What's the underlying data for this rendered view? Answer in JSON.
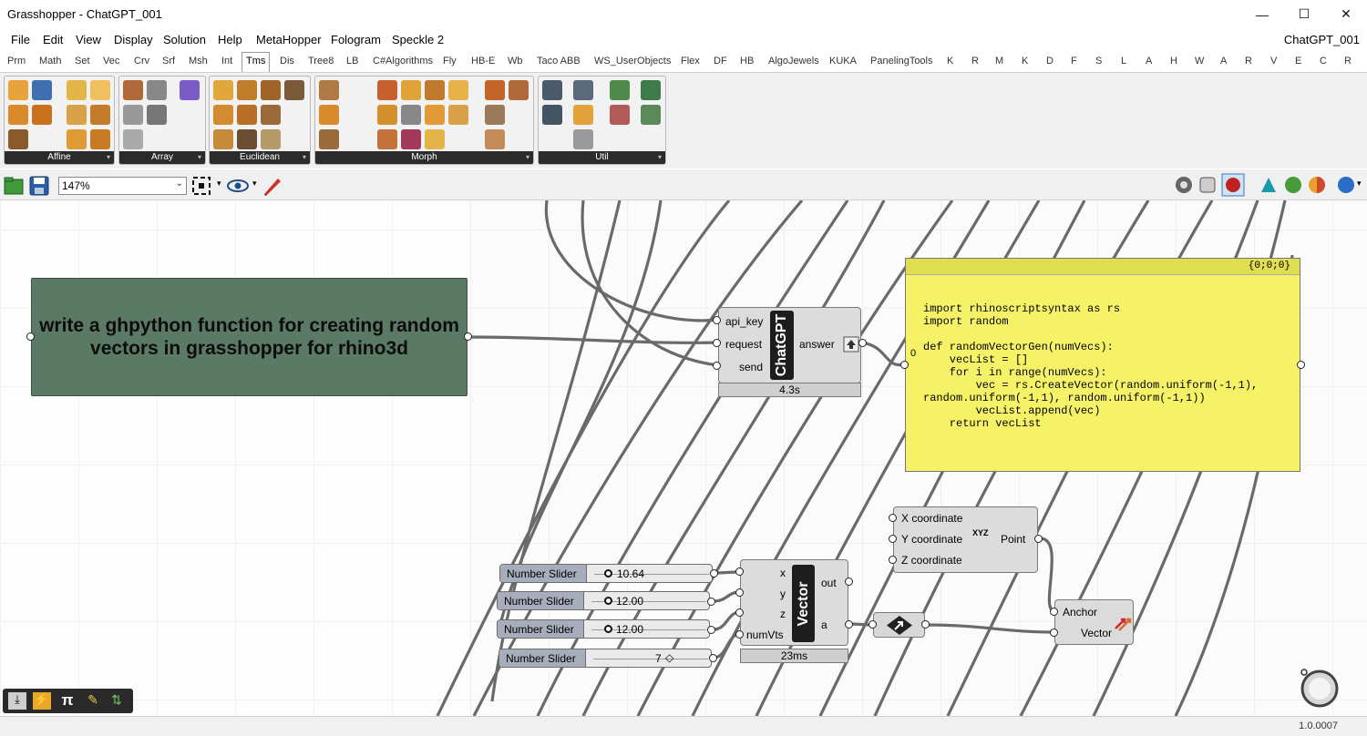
{
  "window": {
    "title": "Grasshopper - ChatGPT_001",
    "controls": [
      "—",
      "☐",
      "✕"
    ]
  },
  "menu": {
    "items": [
      "File",
      "Edit",
      "View",
      "Display",
      "Solution",
      "Help",
      "MetaHopper",
      "Fologram",
      "Speckle 2"
    ],
    "document": "ChatGPT_001"
  },
  "tabs": [
    "Prm",
    "Math",
    "Set",
    "Vec",
    "Crv",
    "Srf",
    "Msh",
    "Int",
    "Tms",
    "Dis",
    "Tree8",
    "LB",
    "C#Algorithms",
    "Fly",
    "HB-E",
    "Wb",
    "Taco ABB",
    "WS_UserObjects",
    "Flex",
    "DF",
    "HB",
    "AlgoJewels",
    "KUKA",
    "PanelingTools",
    "K",
    "R",
    "M",
    "K",
    "D",
    "F",
    "S",
    "L",
    "A",
    "H",
    "W",
    "A",
    "R",
    "V",
    "E",
    "C",
    "R"
  ],
  "active_tab": "Tms",
  "ribbon": {
    "panels": [
      "Affine",
      "Array",
      "Euclidean",
      "Morph",
      "Util"
    ]
  },
  "toolbar": {
    "zoom": "147%"
  },
  "canvas": {
    "prompt": "write a ghpython function for creating random vectors in grasshopper for rhino3d",
    "chatgpt": {
      "bar": "ChatGPT",
      "inputs": [
        "api_key",
        "request",
        "send"
      ],
      "output": "answer",
      "timer": "4.3s"
    },
    "code_panel": {
      "path": "{0;0;0}",
      "index": "0",
      "code": "import rhinoscriptsyntax as rs\nimport random\n\ndef randomVectorGen(numVecs):\n    vecList = []\n    for i in range(numVecs):\n        vec = rs.CreateVector(random.uniform(-1,1),\nrandom.uniform(-1,1), random.uniform(-1,1))\n        vecList.append(vec)\n    return vecList"
    },
    "sliders": [
      {
        "name": "Number Slider",
        "value": "10.64"
      },
      {
        "name": "Number Slider",
        "value": "12.00"
      },
      {
        "name": "Number Slider",
        "value": "12.00"
      },
      {
        "name": "Number Slider",
        "value": "7"
      }
    ],
    "vector": {
      "bar": "Vector",
      "inputs": [
        "x",
        "y",
        "z",
        "numVts"
      ],
      "outputs": [
        "out",
        "a"
      ],
      "timer": "23ms"
    },
    "point": {
      "inputs": [
        "X coordinate",
        "Y coordinate",
        "Z coordinate"
      ],
      "glyph": "XYZ",
      "output": "Point"
    },
    "vecdisplay": {
      "inputs": [
        "Anchor",
        "Vector"
      ]
    }
  },
  "bottom_tools": [
    "⤓",
    "⚡",
    "π",
    "✎",
    "⇅"
  ],
  "status": {
    "version": "1.0.0007"
  }
}
